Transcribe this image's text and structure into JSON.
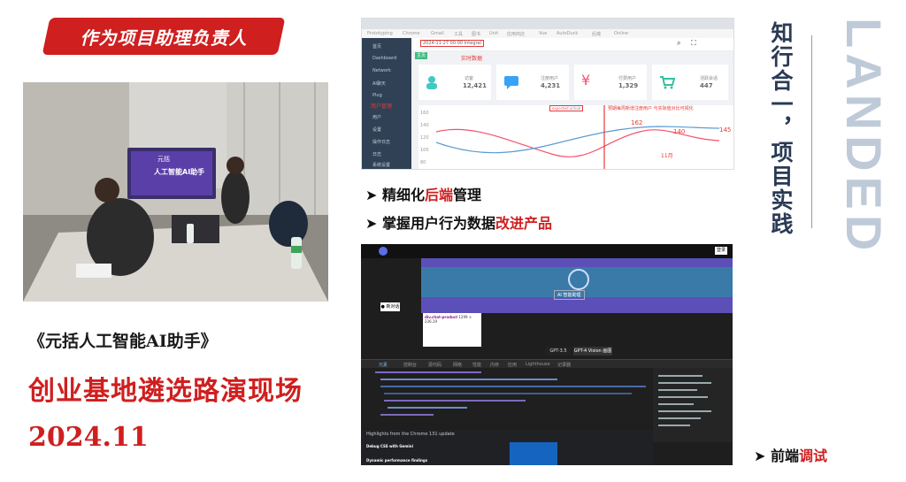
{
  "banner": {
    "text": "作为项目助理负责人"
  },
  "photo": {
    "screen_line1": "元括",
    "screen_line2": "人工智能AI助手"
  },
  "captions": {
    "event_name": "《元括人工智能AI助手》",
    "event_scene": "创业基地遴选路演现场",
    "date": "2024.11"
  },
  "admin_screenshot": {
    "browser_tabs": [
      "Prototyping",
      "Chrome",
      "Gmail",
      "工具",
      "图书",
      "Unit",
      "应用商店",
      "Vue",
      "AutoDuck",
      "后端",
      "Online"
    ],
    "sidebar_items": [
      "首页",
      "Dashboard",
      "Network",
      "AI聊天",
      "Plug",
      "用户",
      "设置",
      "操作日志",
      "日志",
      "系统设置"
    ],
    "sidebar_annotation": "用户管理",
    "breadcrumb": "2024-11-27 00:00 Integral",
    "realtime_label": "实时数据",
    "tab_label": "主页",
    "stats": [
      {
        "label": "访客",
        "value": "12,421",
        "color": "#40c9c6"
      },
      {
        "label": "注册用户",
        "value": "4,231",
        "color": "#36a3f7"
      },
      {
        "label": "付费用户",
        "value": "1,329",
        "color": "#f4516c"
      },
      {
        "label": "活跃会话",
        "value": "447",
        "color": "#34bfa3"
      }
    ],
    "chart_legend": [
      "expected",
      "actual"
    ],
    "chart_annotation": "预期每周新增注册用户 与实际值对比可视化",
    "month_label": "11月",
    "chart_data": {
      "type": "line",
      "y_ticks": [
        "160",
        "140",
        "120",
        "100",
        "80"
      ],
      "point_labels": [
        "162",
        "140",
        "145"
      ],
      "series": [
        {
          "name": "expected",
          "color": "#f4516c"
        },
        {
          "name": "actual",
          "color": "#5b9bd5"
        }
      ]
    }
  },
  "bullets": [
    {
      "prefix": "精细化",
      "highlight": "后端",
      "suffix": "管理"
    },
    {
      "prefix": "掌握用户行为数据",
      "highlight": "改进产品",
      "suffix": ""
    }
  ],
  "devtools_screenshot": {
    "header_button": "登录",
    "hero_button": "AI 智能助理",
    "side_button": "● 新对话",
    "tooltip_title": "div.chat-product",
    "tooltip_size": "1299 × 236.19",
    "model_tabs": [
      "GPT-3.5",
      "GPT-4 Vision 画图"
    ],
    "devtools_tabs": [
      "元素",
      "控制台",
      "源代码",
      "网络",
      "性能",
      "内存",
      "应用",
      "Lighthouse",
      "记录器"
    ],
    "console_hint": "Highlights from the Chrome 131 update",
    "console_item1": "Debug CSS with Gemini",
    "console_item2": "Dynamic performance findings"
  },
  "bullet3": {
    "prefix": "前端",
    "highlight": "调试"
  },
  "right_title": "知行合一，项目实践",
  "landed": "LANDED",
  "colors": {
    "accent_red": "#cf1f1f",
    "admin_sidebar": "#304156",
    "landed_blue": "#bfcad9"
  }
}
